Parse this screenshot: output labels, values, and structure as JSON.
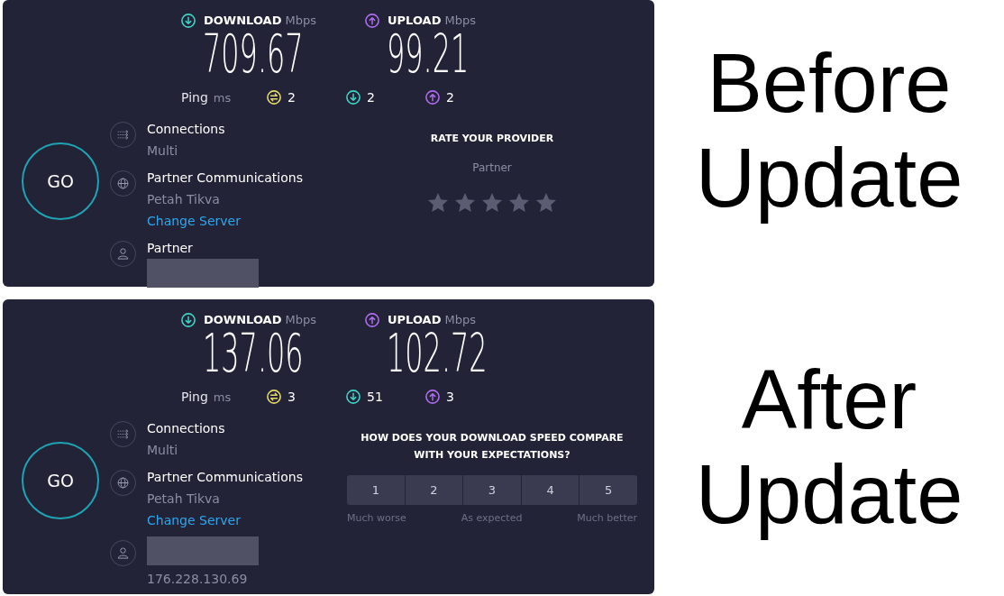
{
  "panels": [
    {
      "download": {
        "label": "DOWNLOAD",
        "unit": "Mbps",
        "value": "709.67"
      },
      "upload": {
        "label": "UPLOAD",
        "unit": "Mbps",
        "value": "99.21"
      },
      "ping": {
        "label": "Ping",
        "unit": "ms",
        "readings": [
          {
            "kind": "idle",
            "value": "2"
          },
          {
            "kind": "download",
            "value": "2"
          },
          {
            "kind": "upload",
            "value": "2"
          }
        ]
      },
      "go_button": "GO",
      "details": [
        {
          "kind": "connections",
          "title": "Connections",
          "lines": [
            {
              "kind": "text",
              "text": "Multi"
            }
          ]
        },
        {
          "kind": "server",
          "title": "Partner Communications",
          "lines": [
            {
              "kind": "text",
              "text": "Petah Tikva"
            },
            {
              "kind": "link",
              "text": "Change Server"
            }
          ]
        },
        {
          "kind": "provider",
          "title": "Partner",
          "lines": [
            {
              "kind": "redacted"
            }
          ]
        }
      ],
      "feedback": {
        "kind": "rating",
        "title": "RATE YOUR PROVIDER",
        "provider": "Partner",
        "stars": 0
      }
    },
    {
      "download": {
        "label": "DOWNLOAD",
        "unit": "Mbps",
        "value": "137.06"
      },
      "upload": {
        "label": "UPLOAD",
        "unit": "Mbps",
        "value": "102.72"
      },
      "ping": {
        "label": "Ping",
        "unit": "ms",
        "readings": [
          {
            "kind": "idle",
            "value": "3"
          },
          {
            "kind": "download",
            "value": "51"
          },
          {
            "kind": "upload",
            "value": "3"
          }
        ]
      },
      "go_button": "GO",
      "details": [
        {
          "kind": "connections",
          "title": "Connections",
          "lines": [
            {
              "kind": "text",
              "text": "Multi"
            }
          ]
        },
        {
          "kind": "server",
          "title": "Partner Communications",
          "lines": [
            {
              "kind": "text",
              "text": "Petah Tikva"
            },
            {
              "kind": "link",
              "text": "Change Server"
            }
          ]
        },
        {
          "kind": "provider",
          "lines": [
            {
              "kind": "redacted"
            },
            {
              "kind": "text",
              "text": "176.228.130.69"
            }
          ]
        }
      ],
      "feedback": {
        "kind": "scale",
        "title": "HOW DOES YOUR DOWNLOAD SPEED COMPARE WITH YOUR EXPECTATIONS?",
        "options": [
          {
            "label": "1",
            "selected": false
          },
          {
            "label": "2",
            "selected": false
          },
          {
            "label": "3",
            "selected": false
          },
          {
            "label": "4",
            "selected": false
          },
          {
            "label": "5",
            "selected": false
          }
        ],
        "scale_labels": [
          "Much worse",
          "As expected",
          "Much better"
        ]
      }
    }
  ],
  "captions": [
    "Before Update",
    "After Update"
  ]
}
